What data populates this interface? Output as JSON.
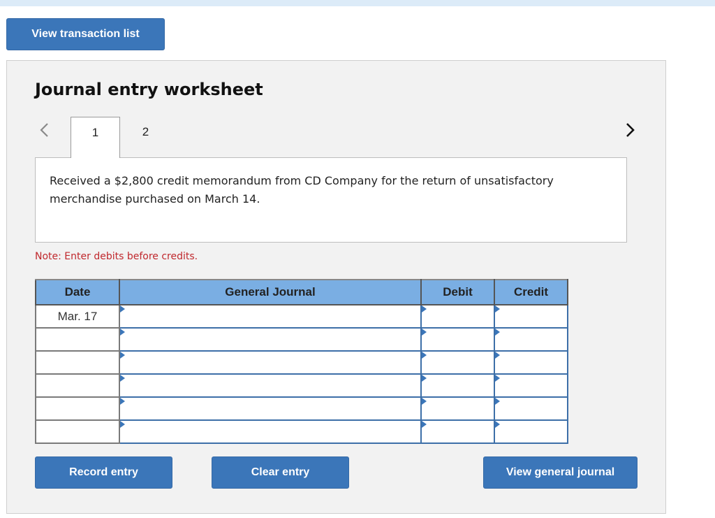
{
  "top_button": "View transaction list",
  "worksheet": {
    "title": "Journal entry worksheet",
    "tabs": [
      {
        "label": "1",
        "active": true
      },
      {
        "label": "2",
        "active": false
      }
    ],
    "description": "Received a $2,800 credit memorandum from CD Company for the return of unsatisfactory merchandise purchased on March 14.",
    "note": "Note: Enter debits before credits.",
    "table": {
      "headers": {
        "date": "Date",
        "general_journal": "General Journal",
        "debit": "Debit",
        "credit": "Credit"
      },
      "rows": [
        {
          "date": "Mar. 17",
          "account": "",
          "debit": "",
          "credit": ""
        },
        {
          "date": "",
          "account": "",
          "debit": "",
          "credit": ""
        },
        {
          "date": "",
          "account": "",
          "debit": "",
          "credit": ""
        },
        {
          "date": "",
          "account": "",
          "debit": "",
          "credit": ""
        },
        {
          "date": "",
          "account": "",
          "debit": "",
          "credit": ""
        },
        {
          "date": "",
          "account": "",
          "debit": "",
          "credit": ""
        }
      ]
    },
    "buttons": {
      "record": "Record entry",
      "clear": "Clear entry",
      "view_journal": "View general journal"
    }
  },
  "icons": {
    "prev": "chevron-left-icon",
    "next": "chevron-right-icon"
  }
}
